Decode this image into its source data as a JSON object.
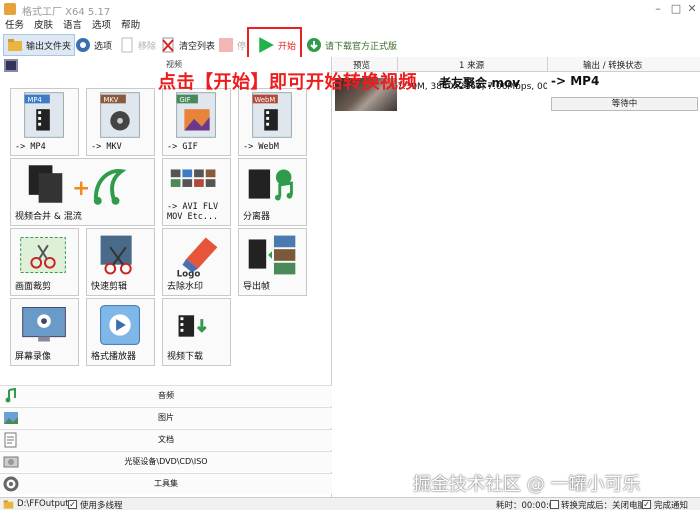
{
  "window": {
    "title": "格式工厂 X64 5.17"
  },
  "menu": [
    "任务",
    "皮肤",
    "语言",
    "选项",
    "帮助"
  ],
  "toolbar": {
    "output_folder": "输出文件夹",
    "options": "选项",
    "remove": "移除",
    "clear_list": "清空列表",
    "stop": "停",
    "start": "开始",
    "official": "请下载官方正式版"
  },
  "annotation": "点击【开始】即可开始转换视频",
  "left_panel": {
    "header": "视频",
    "tiles": [
      {
        "label": "-> MP4",
        "icon": "mp4-file-icon",
        "badge": "MP4"
      },
      {
        "label": "-> MKV",
        "icon": "mkv-file-icon",
        "badge": "MKV"
      },
      {
        "label": "-> GIF",
        "icon": "gif-file-icon",
        "badge": "GIF"
      },
      {
        "label": "-> WebM",
        "icon": "webm-file-icon",
        "badge": "WebM"
      },
      {
        "label": "视频合并 & 混流",
        "icon": "merge-icon"
      },
      {
        "label": "-> AVI FLV\nMOV Etc...",
        "icon": "format-list-icon"
      },
      {
        "label": "分离器",
        "icon": "splitter-icon"
      },
      {
        "label": "画面裁剪",
        "icon": "crop-icon"
      },
      {
        "label": "快速剪辑",
        "icon": "quick-cut-icon"
      },
      {
        "label": "去除水印",
        "icon": "eraser-icon",
        "badge": "Logo"
      },
      {
        "label": "导出帧",
        "icon": "export-frames-icon"
      },
      {
        "label": "屏幕录像",
        "icon": "screen-record-icon"
      },
      {
        "label": "格式播放器",
        "icon": "player-icon"
      },
      {
        "label": "视频下载",
        "icon": "download-icon"
      }
    ],
    "categories": [
      "音频",
      "图片",
      "文档",
      "光驱设备\\DVD\\CD\\ISO",
      "工具集"
    ]
  },
  "right_panel": {
    "columns": [
      "预览",
      "1 来源",
      "输出 / 转换状态"
    ],
    "file": {
      "name": "老友聚会.mov",
      "target": "-> MP4",
      "info": "7.39M, 3840x2160, 7.06Mbps, 00:00:",
      "status": "等待中"
    }
  },
  "statusbar": {
    "output_path": "D:\\FFOutput",
    "multithread": "使用多线程",
    "elapsed": "耗时：00:00:00",
    "after_done": "转换完成后：关闭电脑",
    "notify": "完成通知"
  },
  "watermark": "掘金技术社区 @ 一罐小可乐",
  "colors": {
    "accent_red": "#e8231f",
    "start_green": "#22b24c"
  }
}
